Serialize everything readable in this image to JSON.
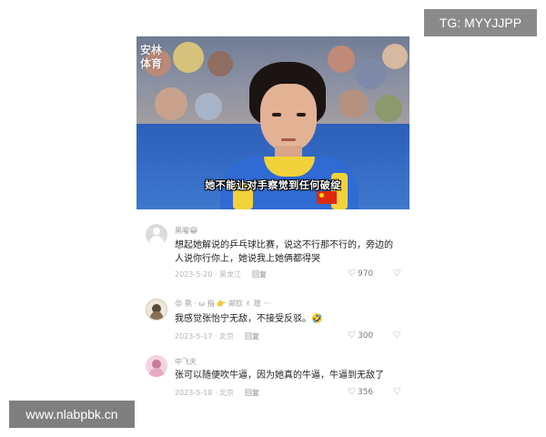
{
  "watermarks": {
    "telegram": "TG: MYYJJPP",
    "site": "www.nlabpbk.cn"
  },
  "video": {
    "logo_text": "安林\n体育",
    "subtitle": "她不能让对手察觉到任何破绽",
    "colors": {
      "jersey": "#2f6bd3",
      "collar": "#f2d23a",
      "flag": "#de2910"
    }
  },
  "comments": [
    {
      "username": "黑曜",
      "username_emoji": "😁",
      "text": "想起她解说的乒乓球比赛，说这不行那不行的，旁边的人说你行你上，她说我上她俩都得哭",
      "date": "2023-5-20",
      "location": "黑龙江",
      "reply_label": "回复",
      "likes": "970",
      "avatar_icon": "default-avatar-icon"
    },
    {
      "username": "😡 熬 · ω 指 👉 郑钦 ✌ 瑄 ·ᵕ·",
      "username_emoji": "",
      "text": "我感觉张怡宁无敌，不接受反驳。🤣",
      "date": "2023-5-17",
      "location": "北京",
      "reply_label": "回复",
      "likes": "300",
      "avatar_icon": "user-photo-avatar-icon"
    },
    {
      "username": "中飞天",
      "username_emoji": "",
      "text": "张可以随便吹牛逼，因为她真的牛逼，牛逼到无敌了",
      "date": "2023-5-18",
      "location": "北京",
      "reply_label": "回复",
      "likes": "356",
      "avatar_icon": "pink-avatar-icon"
    }
  ]
}
